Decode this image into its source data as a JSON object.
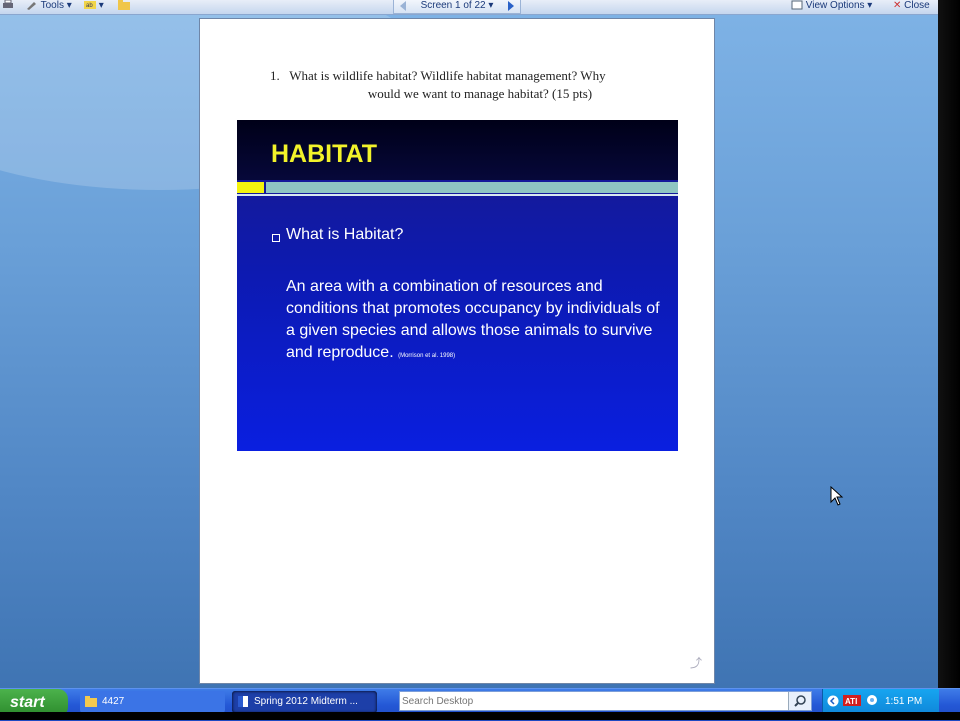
{
  "toolbar": {
    "tools_label": "Tools",
    "page_nav_label": "Screen 1 of 22",
    "view_options_label": "View Options",
    "close_label": "Close"
  },
  "document": {
    "question_number": "1.",
    "question_line1": "What is wildlife habitat?  Wildlife habitat management? Why",
    "question_line2": "would we want to manage habitat? (15 pts)"
  },
  "slide": {
    "title": "HABITAT",
    "bullet": "What is Habitat?",
    "body": "An area with a combination of resources and conditions that promotes occupancy by individuals of a given species and allows those animals to survive and reproduce.",
    "citation": "(Morrison et al. 1998)",
    "colors": {
      "title": "#f2f22a",
      "accent_yellow": "#f4f40e",
      "accent_teal": "#8fc6c2"
    }
  },
  "taskbar": {
    "start_label": "start",
    "tasks": [
      {
        "label": "4427",
        "icon": "folder-icon"
      },
      {
        "label": "Spring 2012 Midterm ...",
        "icon": "word-document-icon"
      }
    ],
    "search_placeholder": "Search Desktop",
    "clock": "1:51 PM"
  }
}
